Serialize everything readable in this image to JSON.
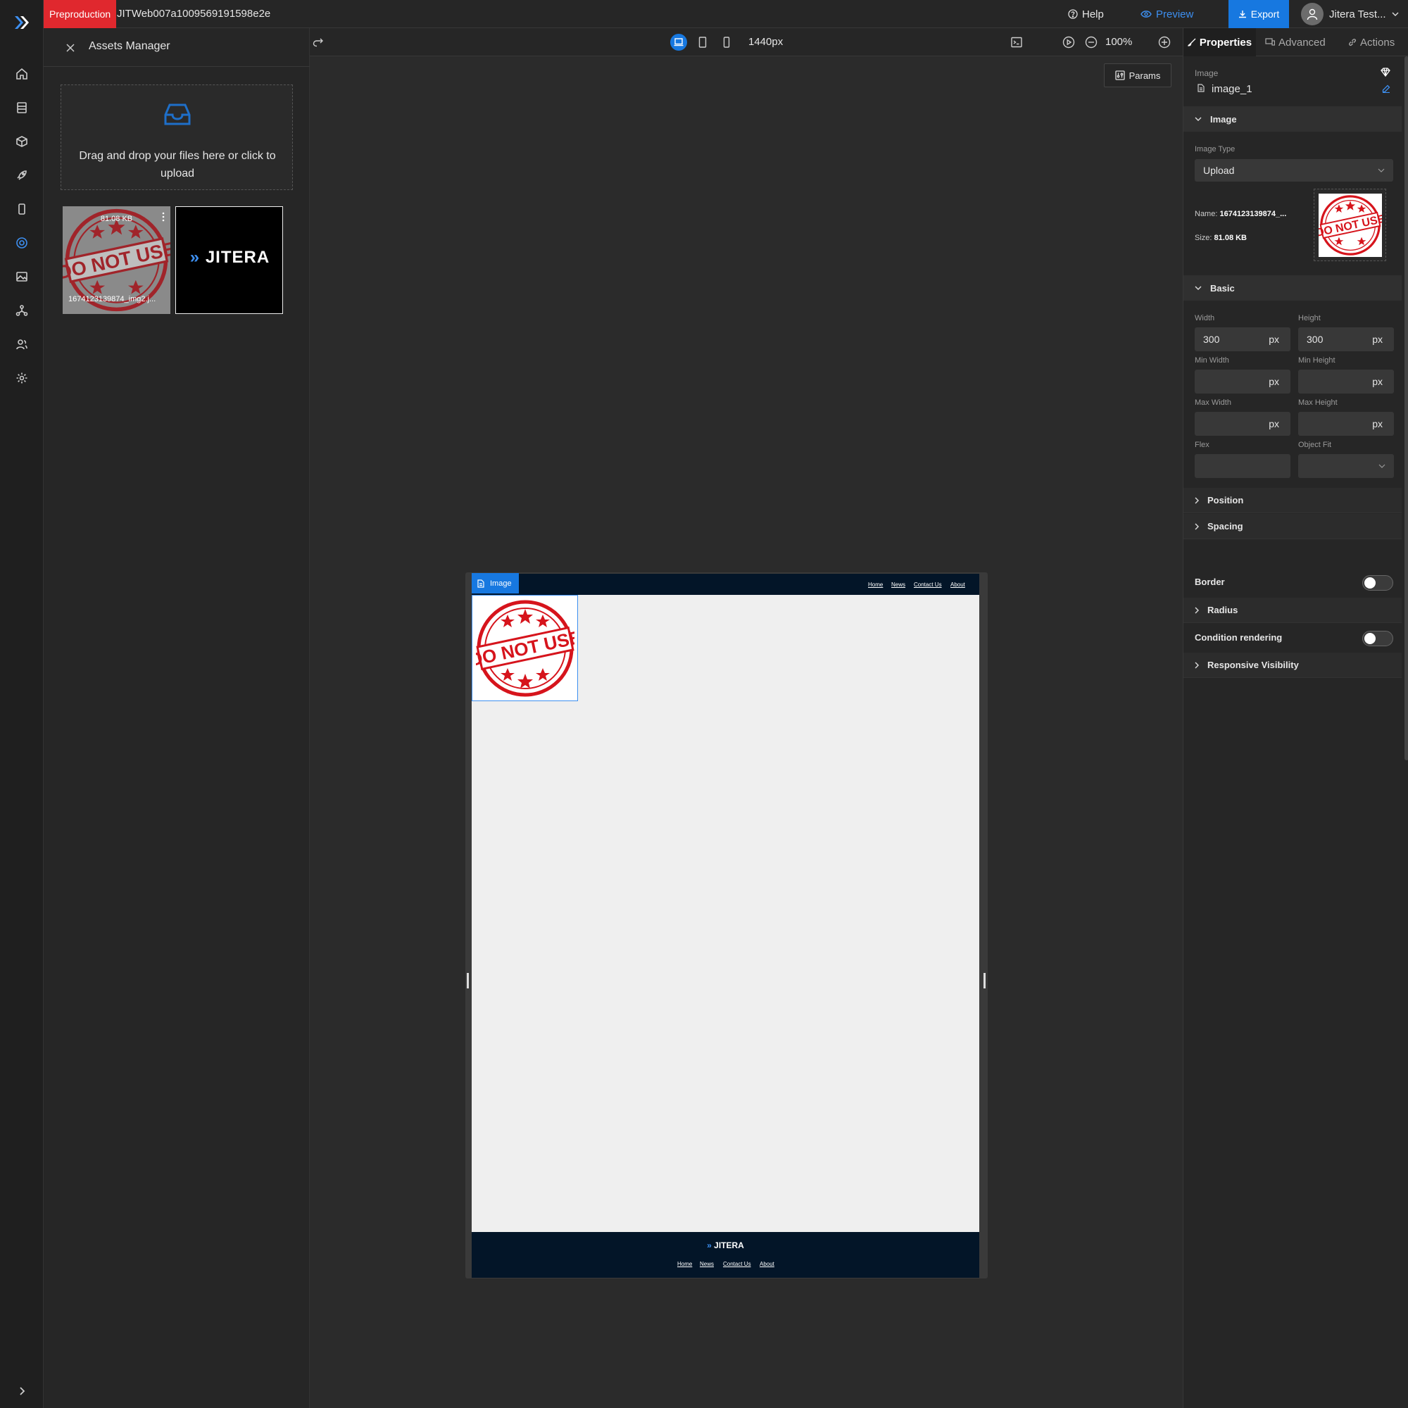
{
  "app": {
    "env_badge": "Preproduction",
    "project_id": "JITWeb007a1009569191598e2e",
    "help_label": "Help",
    "preview_label": "Preview",
    "export_label": "Export",
    "user_name": "Jitera Test..."
  },
  "rail": {
    "icons": [
      "logo-icon",
      "home-icon",
      "database-icon",
      "cube-icon",
      "rocket-icon",
      "mobile-icon",
      "palette-icon",
      "image-gallery-icon",
      "network-icon",
      "users-icon",
      "gear-icon",
      "expand-icon"
    ]
  },
  "canvas_toolbar": {
    "width_label": "1440px",
    "zoom_label": "100%",
    "params_label": "Params"
  },
  "assets": {
    "title": "Assets Manager",
    "dropzone_text": "Drag and drop your files here or click to upload",
    "items": [
      {
        "size": "81.08 KB",
        "name": "1674123139874_img2.j...",
        "stamp_text": "DO NOT USE"
      },
      {
        "logo_text": "JITERA"
      }
    ]
  },
  "page": {
    "nav": [
      "Home",
      "News",
      "Contact Us",
      "About"
    ],
    "selected_tag": "Image",
    "image_stamp_text": "DO NOT USE",
    "footer_logo": "JITERA",
    "footer_nav": [
      "Home",
      "News",
      "Contact Us",
      "About"
    ]
  },
  "props": {
    "tabs": [
      "Properties",
      "Advanced",
      "Actions"
    ],
    "element_type": "Image",
    "element_name": "image_1",
    "image_section": "Image",
    "image_type_label": "Image Type",
    "image_type_value": "Upload",
    "name_label": "Name:",
    "name_value": "1674123139874_...",
    "size_label": "Size:",
    "size_value": "81.08 KB",
    "basic_section": "Basic",
    "width_label": "Width",
    "width_value": "300",
    "height_label": "Height",
    "height_value": "300",
    "min_width_label": "Min Width",
    "min_height_label": "Min Height",
    "max_width_label": "Max Width",
    "max_height_label": "Max Height",
    "unit": "px",
    "flex_label": "Flex",
    "object_fit_label": "Object Fit",
    "position_section": "Position",
    "spacing_section": "Spacing",
    "border_label": "Border",
    "radius_section": "Radius",
    "condition_label": "Condition rendering",
    "responsive_section": "Responsive Visibility"
  },
  "colors": {
    "accent": "#1778e0",
    "badge": "#e0282e",
    "page_header": "#031528",
    "stamp": "#d6141c"
  }
}
